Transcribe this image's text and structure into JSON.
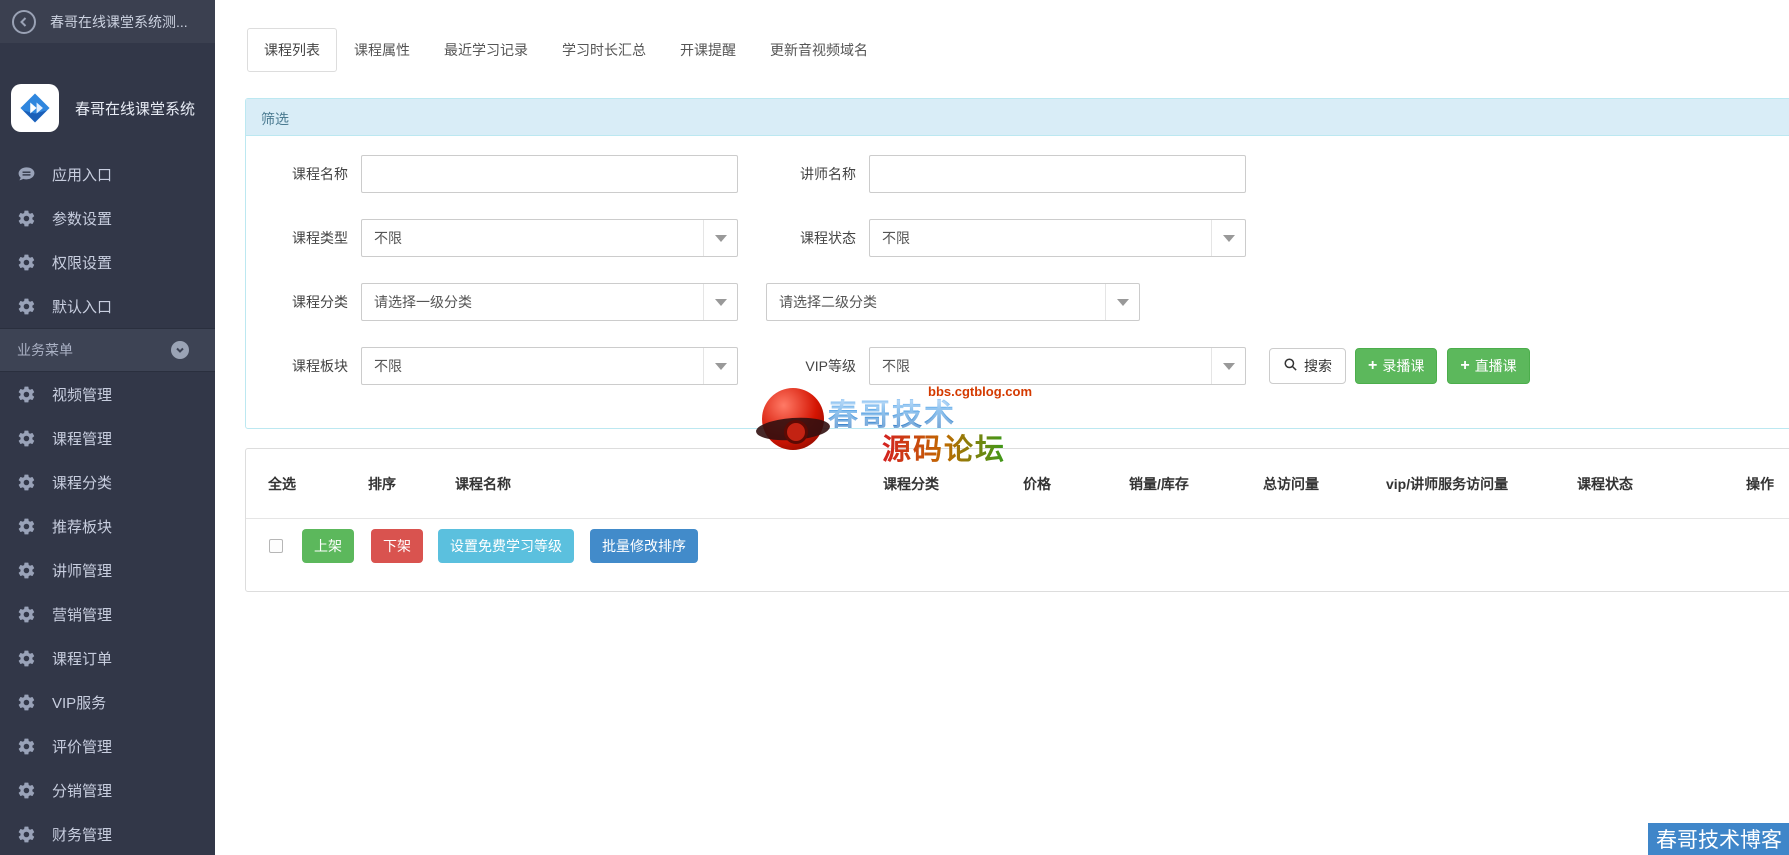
{
  "window": {
    "back_title": "春哥在线课堂系统测...",
    "logo_text": "春哥在线课堂系统"
  },
  "sidebar": {
    "items": [
      {
        "label": "应用入口",
        "icon": "comment-icon"
      },
      {
        "label": "参数设置",
        "icon": "gear-icon"
      },
      {
        "label": "权限设置",
        "icon": "gear-icon"
      },
      {
        "label": "默认入口",
        "icon": "gear-icon"
      },
      {
        "label": "业务菜单",
        "icon": "chevron-down-circle-icon",
        "type": "section"
      },
      {
        "label": "视频管理",
        "icon": "gear-icon"
      },
      {
        "label": "课程管理",
        "icon": "gear-icon"
      },
      {
        "label": "课程分类",
        "icon": "gear-icon"
      },
      {
        "label": "推荐板块",
        "icon": "gear-icon"
      },
      {
        "label": "讲师管理",
        "icon": "gear-icon"
      },
      {
        "label": "营销管理",
        "icon": "gear-icon"
      },
      {
        "label": "课程订单",
        "icon": "gear-icon"
      },
      {
        "label": "VIP服务",
        "icon": "gear-icon"
      },
      {
        "label": "评价管理",
        "icon": "gear-icon"
      },
      {
        "label": "分销管理",
        "icon": "gear-icon"
      },
      {
        "label": "财务管理",
        "icon": "gear-icon"
      }
    ]
  },
  "tabs": [
    {
      "label": "课程列表",
      "active": true
    },
    {
      "label": "课程属性",
      "active": false
    },
    {
      "label": "最近学习记录",
      "active": false
    },
    {
      "label": "学习时长汇总",
      "active": false
    },
    {
      "label": "开课提醒",
      "active": false
    },
    {
      "label": "更新音视频域名",
      "active": false
    }
  ],
  "filter": {
    "title": "筛选",
    "course_name_label": "课程名称",
    "course_name_value": "",
    "teacher_name_label": "讲师名称",
    "teacher_name_value": "",
    "course_type_label": "课程类型",
    "course_type_value": "不限",
    "course_status_label": "课程状态",
    "course_status_value": "不限",
    "course_category_label": "课程分类",
    "category_l1_value": "请选择一级分类",
    "category_l2_value": "请选择二级分类",
    "course_module_label": "课程板块",
    "course_module_value": "不限",
    "vip_level_label": "VIP等级",
    "vip_level_value": "不限",
    "search_label": "搜索",
    "record_course_label": "录播课",
    "live_course_label": "直播课"
  },
  "table": {
    "columns": [
      "全选",
      "排序",
      "课程名称",
      "课程分类",
      "价格",
      "销量/库存",
      "总访问量",
      "vip/讲师服务访问量",
      "课程状态",
      "操作"
    ],
    "bulk_actions": [
      {
        "label": "上架",
        "color": "#5cb85c"
      },
      {
        "label": "下架",
        "color": "#d9534f"
      },
      {
        "label": "设置免费学习等级",
        "color": "#5bc0de"
      },
      {
        "label": "批量修改排序",
        "color": "#428bca"
      }
    ]
  },
  "watermark": {
    "brand": "春哥技术",
    "url": "bbs.cgtblog.com",
    "forum": "源码论坛"
  },
  "corner_badge": "春哥技术博客",
  "colors": {
    "sidebar_bg": "#323748",
    "topbar_bg": "#3b4050",
    "section_bg": "#3d4354",
    "filter_header_bg": "#d9edf7",
    "filter_border": "#bce8f1",
    "green": "#5cb85c",
    "red": "#d9534f",
    "light_blue": "#5bc0de",
    "blue": "#428bca",
    "badge_blue": "#3f86c9"
  }
}
